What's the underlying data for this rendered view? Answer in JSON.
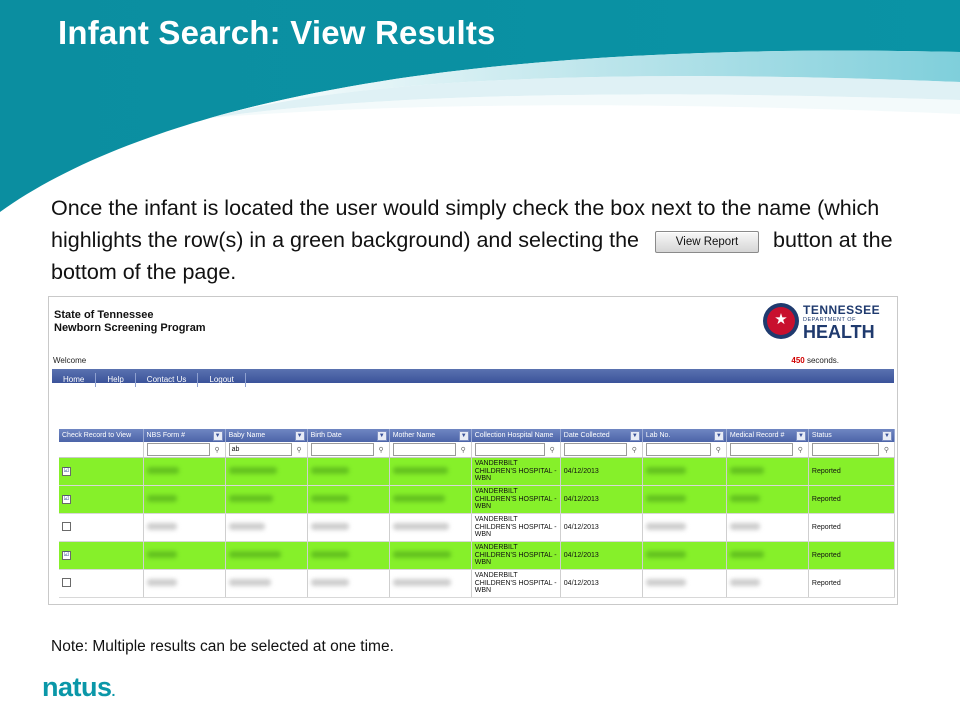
{
  "slide": {
    "title": "Infant Search: View Results",
    "paragraph_part1": "Once the infant is located the user would simply check the box next to the name (which highlights the row(s) in a green background) and selecting the",
    "inline_button_label": "View Report",
    "paragraph_part2": "button at the bottom of the page.",
    "note": "Note: Multiple results can be selected at one time.",
    "brand": "natus",
    "brand_suffix": ".",
    "colors": {
      "teal": "#0b8ea0",
      "selected_row": "#86f02a",
      "nav": "#4c64a8"
    }
  },
  "app": {
    "title_line1": "State of Tennessee",
    "title_line2": "Newborn Screening Program",
    "logo": {
      "line1": "TENNESSEE",
      "line2": "DEPARTMENT OF",
      "line3": "HEALTH",
      "icon": "tri-star-seal-icon"
    },
    "welcome": "Welcome",
    "timer_value": "450",
    "timer_suffix": "seconds.",
    "nav": [
      "Home",
      "Help",
      "Contact Us",
      "Logout"
    ],
    "columns": [
      "Check Record to View",
      "NBS Form #",
      "Baby Name",
      "Birth Date",
      "Mother Name",
      "Collection Hospital Name",
      "Date Collected",
      "Lab No.",
      "Medical Record #",
      "Status"
    ],
    "filter": {
      "baby_name": "ab"
    },
    "rows": [
      {
        "checked": "☑",
        "hospital": "VANDERBILT CHILDREN'S HOSPITAL - WBN",
        "date": "04/12/2013",
        "status": "Reported",
        "selected": true
      },
      {
        "checked": "☑",
        "hospital": "VANDERBILT CHILDREN'S HOSPITAL - WBN",
        "date": "04/12/2013",
        "status": "Reported",
        "selected": true
      },
      {
        "checked": "",
        "hospital": "VANDERBILT CHILDREN'S HOSPITAL - WBN",
        "date": "04/12/2013",
        "status": "Reported",
        "selected": false
      },
      {
        "checked": "☑",
        "hospital": "VANDERBILT CHILDREN'S HOSPITAL - WBN",
        "date": "04/12/2013",
        "status": "Reported",
        "selected": true
      },
      {
        "checked": "",
        "hospital": "VANDERBILT CHILDREN'S HOSPITAL - WBN",
        "date": "04/12/2013",
        "status": "Reported",
        "selected": false
      }
    ]
  }
}
